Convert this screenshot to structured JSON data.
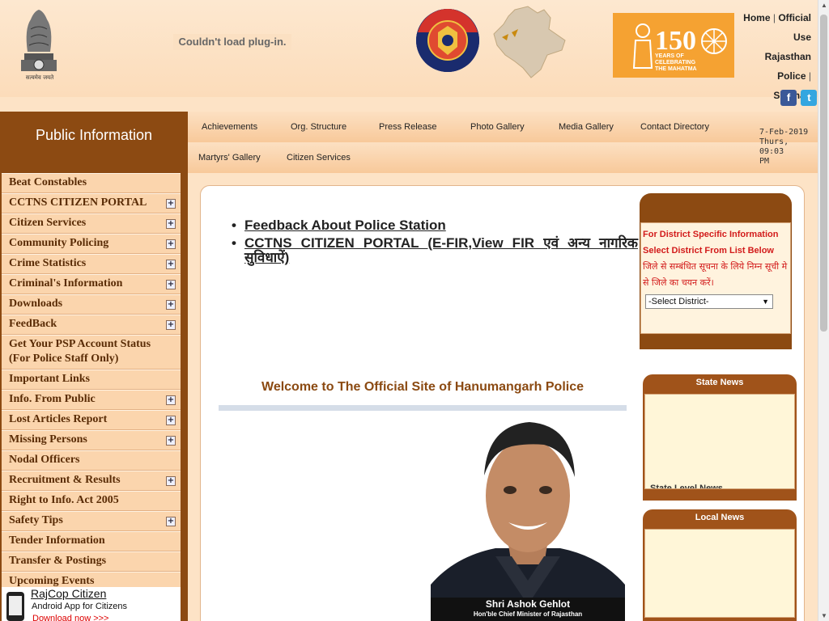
{
  "header": {
    "emblem_caption": "सत्यमेव जयते",
    "plugin_message": "Couldn't load plug-in.",
    "mahatma_banner": {
      "number": "150",
      "text": "YEARS OF CELEBRATING THE MAHATMA"
    },
    "top_links": [
      "Home",
      "Official Use",
      "Rajasthan Police",
      "Sitemap"
    ],
    "social": {
      "facebook": "f",
      "twitter": "t"
    }
  },
  "sidebar": {
    "title": "Public Information",
    "items": [
      {
        "label": "Beat Constables",
        "expandable": false
      },
      {
        "label": "CCTNS CITIZEN PORTAL",
        "expandable": true
      },
      {
        "label": "Citizen Services",
        "expandable": true
      },
      {
        "label": "Community Policing",
        "expandable": true
      },
      {
        "label": "Crime Statistics",
        "expandable": true
      },
      {
        "label": "Criminal's Information",
        "expandable": true
      },
      {
        "label": "Downloads",
        "expandable": true
      },
      {
        "label": "FeedBack",
        "expandable": true
      },
      {
        "label": "Get Your PSP Account Status (For Police Staff Only)",
        "expandable": false
      },
      {
        "label": "Important Links",
        "expandable": false
      },
      {
        "label": "Info. From Public",
        "expandable": true
      },
      {
        "label": "Lost Articles Report",
        "expandable": true
      },
      {
        "label": "Missing Persons",
        "expandable": true
      },
      {
        "label": "Nodal Officers",
        "expandable": false
      },
      {
        "label": "Recruitment & Results",
        "expandable": true
      },
      {
        "label": "Right to Info. Act 2005",
        "expandable": false
      },
      {
        "label": "Safety Tips",
        "expandable": true
      },
      {
        "label": "Tender Information",
        "expandable": false
      },
      {
        "label": "Transfer & Postings",
        "expandable": false
      },
      {
        "label": "Upcoming Events",
        "expandable": false
      }
    ],
    "expand_symbol": "+",
    "app": {
      "title": "RajCop Citizen",
      "subtitle": "Android App for Citizens",
      "link": "Download now >>>"
    }
  },
  "topnav": {
    "items": [
      "Achievements",
      "Org. Structure",
      "Press Release",
      "Photo Gallery",
      "Media Gallery",
      "Contact Directory",
      "Martyrs' Gallery",
      "Citizen Services"
    ],
    "date_line1": "7-Feb-2019",
    "date_line2": "Thurs, 09:03",
    "date_line3": "PM"
  },
  "main": {
    "quick_links": [
      "Feedback About Police Station",
      "CCTNS CITIZEN PORTAL (E-FIR,View FIR एवं अन्य नागरिक सुविधाऐं)"
    ],
    "welcome": "Welcome to The Official Site of Hanumangarh Police",
    "cm_name": "Shri Ashok Gehlot",
    "cm_title": "Hon'ble Chief Minister of Rajasthan"
  },
  "district": {
    "text": "For District Specific Information Select District From List Below",
    "hindi": "जिले से सम्बंधित सूचना के लिये निम्न सूची मे से जिले का चयन करें।",
    "select_value": "-Select District-"
  },
  "news": {
    "state_title": "State News",
    "state_snippet": "State Level News",
    "local_title": "Local News"
  },
  "colors": {
    "sidebar_brown": "#8c4a12",
    "menu_bg": "#fbd5ad",
    "district_red": "#d21b1b",
    "banner_orange": "#f5a232"
  }
}
